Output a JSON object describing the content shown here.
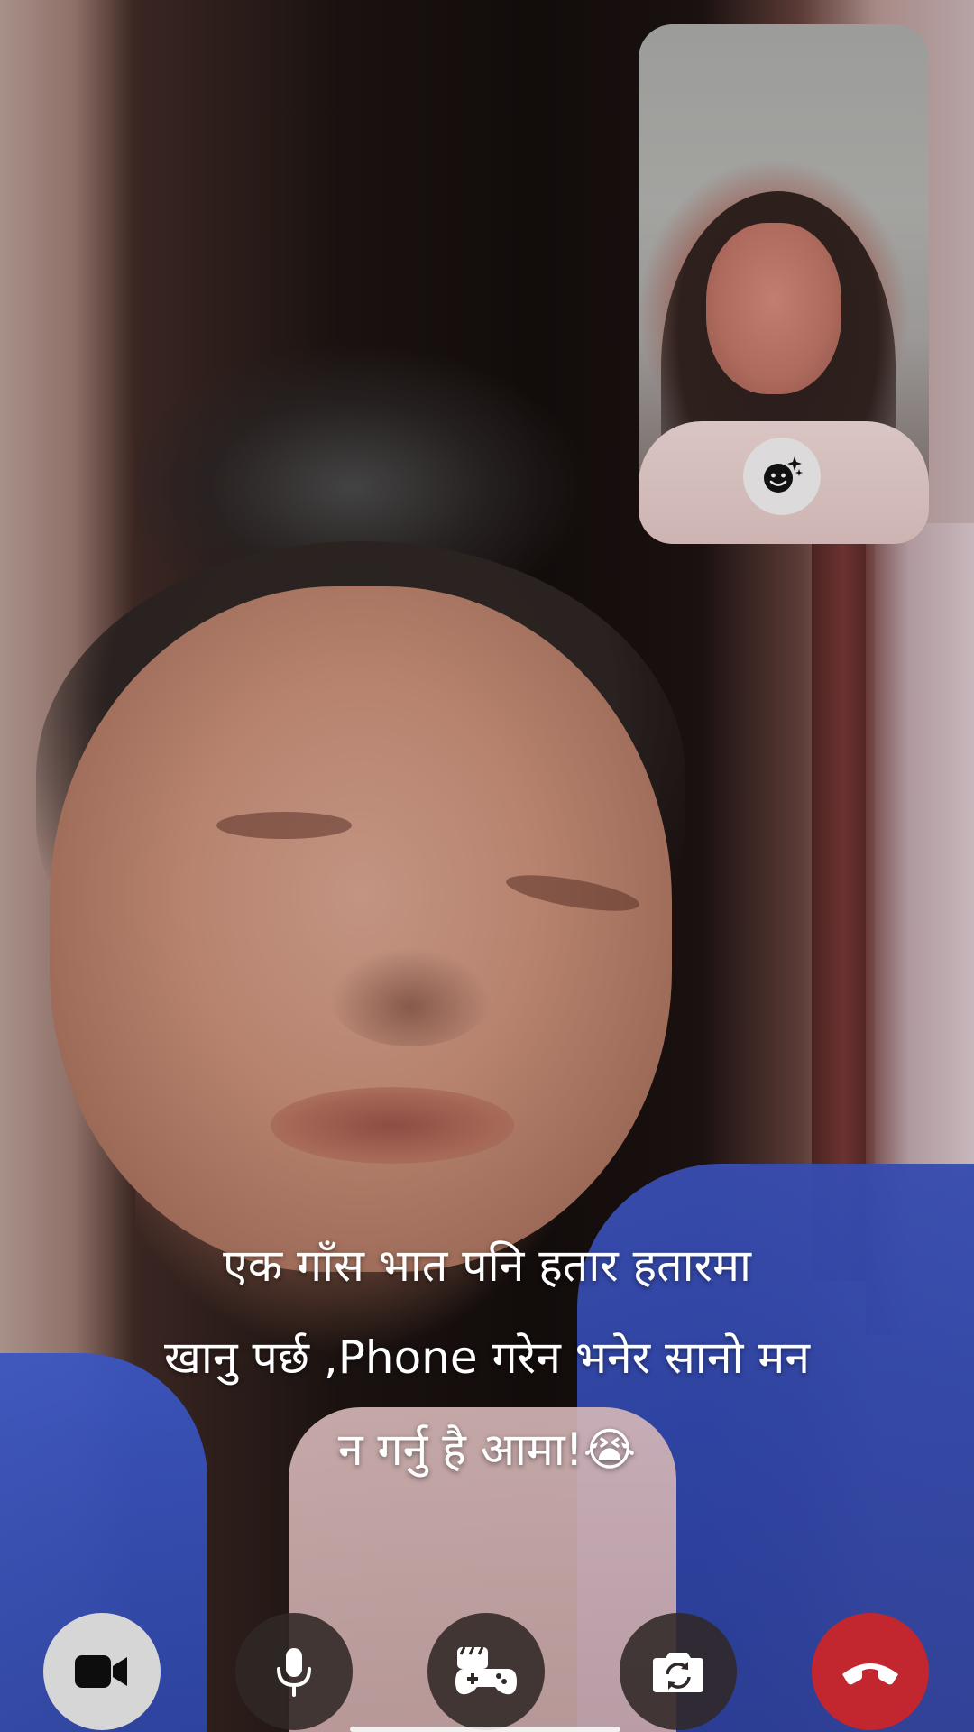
{
  "caption": {
    "line1": "एक  गाँस भात पनि हतार हतारमा",
    "line2": "खानु पर्छ ,Phone गरेन  भनेर सानो मन",
    "line3": "न गर्नु है आमा!😭"
  },
  "controls": [
    {
      "icon": "video-camera-icon",
      "state": "on"
    },
    {
      "icon": "microphone-icon"
    },
    {
      "icon": "game-controller-icon"
    },
    {
      "icon": "flip-camera-icon"
    },
    {
      "icon": "end-call-icon"
    }
  ],
  "self_view": {
    "effects_icon": "face-effects-icon"
  },
  "colors": {
    "end_call": "#c2262f",
    "control_dark": "#302826",
    "control_light": "#d6d6d6",
    "caption_text": "#ffffff"
  }
}
